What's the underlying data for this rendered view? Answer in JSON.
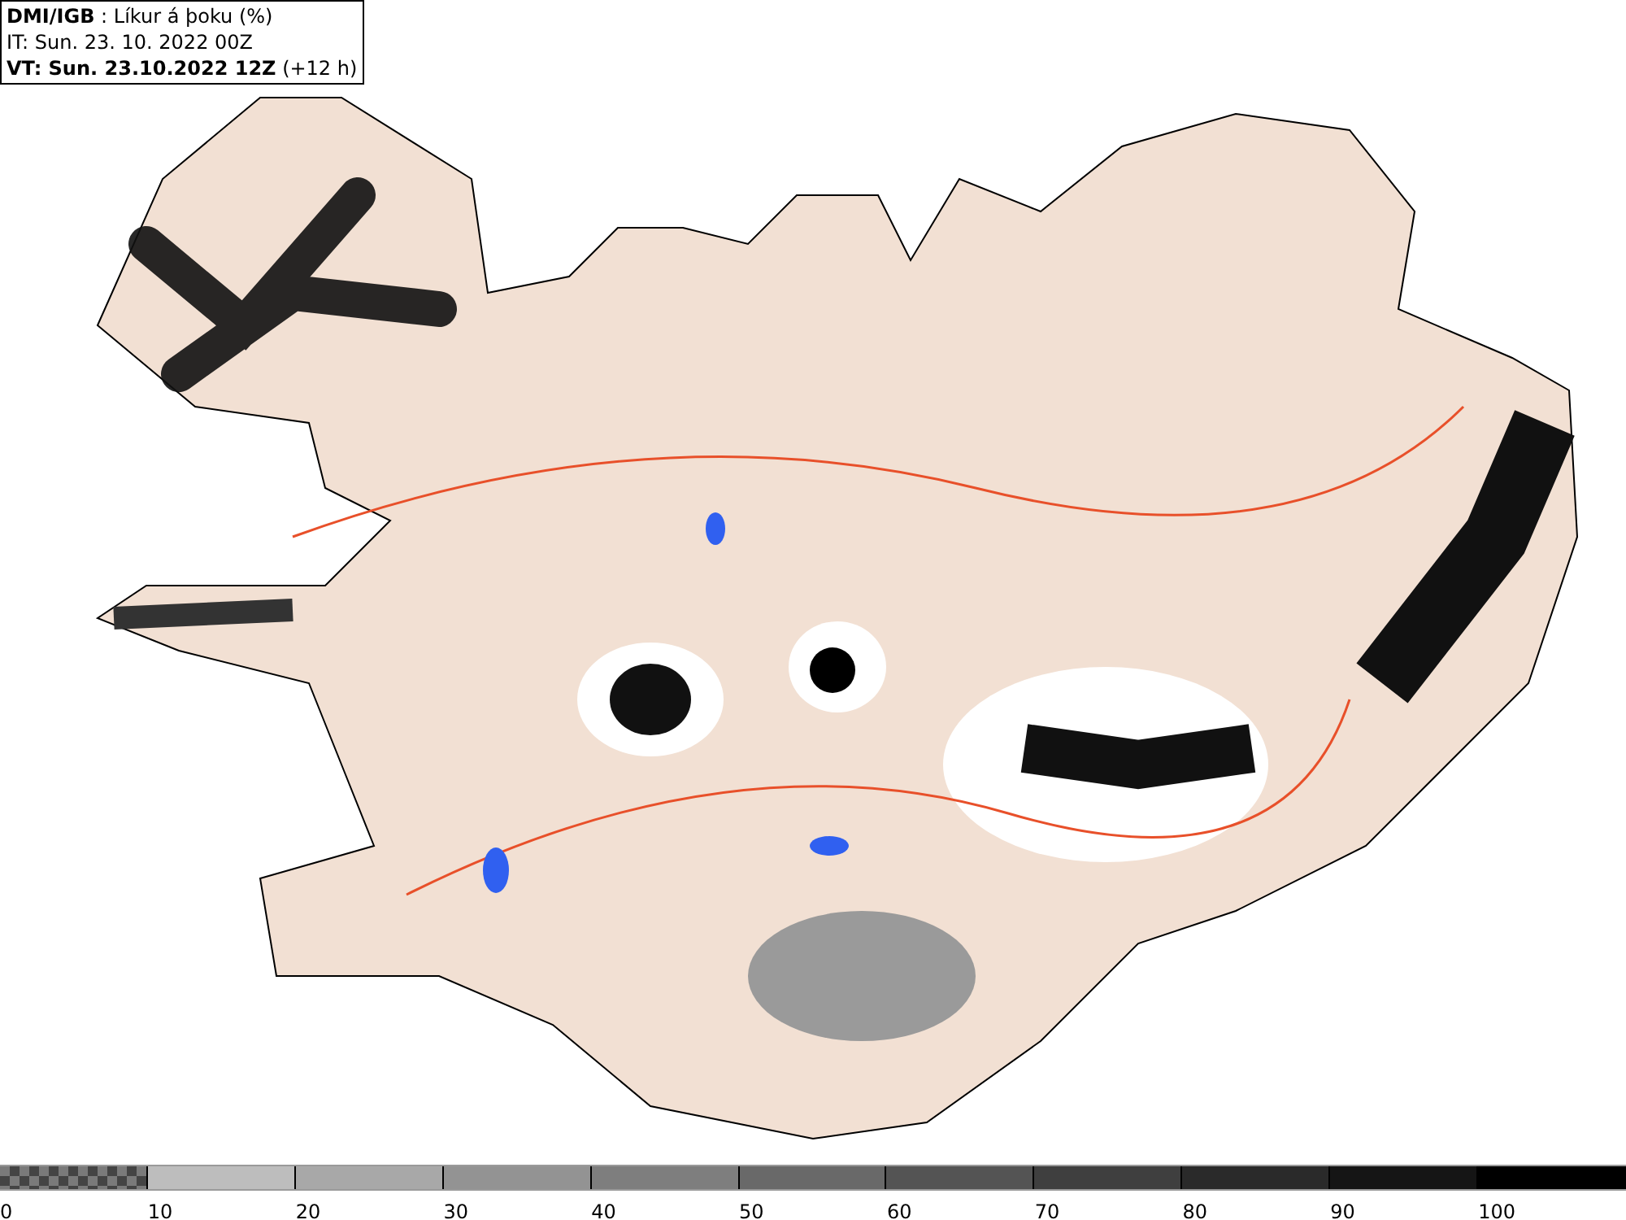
{
  "header": {
    "lines": [
      "**DMI/IGB** : Líkur á þoku (%)",
      "IT: Sun. 23. 10. 2022 00Z",
      "**VT: Sun. 23.10.2022 12Z** (+12 h)"
    ]
  },
  "legend": {
    "segments": [
      {
        "kind": "checker",
        "color": "#7a7a7a"
      },
      {
        "kind": "solid",
        "color": "#bdbdbd"
      },
      {
        "kind": "solid",
        "color": "#a8a8a8"
      },
      {
        "kind": "solid",
        "color": "#939393"
      },
      {
        "kind": "solid",
        "color": "#7e7e7e"
      },
      {
        "kind": "solid",
        "color": "#696969"
      },
      {
        "kind": "solid",
        "color": "#545454"
      },
      {
        "kind": "solid",
        "color": "#3f3f3f"
      },
      {
        "kind": "solid",
        "color": "#2a2a2a"
      },
      {
        "kind": "solid",
        "color": "#151515"
      },
      {
        "kind": "solid",
        "color": "#000000"
      }
    ],
    "labels": [
      "0",
      "10",
      "20",
      "30",
      "40",
      "50",
      "60",
      "70",
      "80",
      "90",
      "100"
    ]
  }
}
